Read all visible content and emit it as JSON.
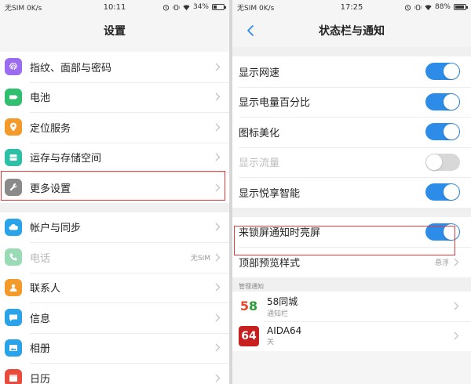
{
  "left": {
    "status": {
      "carrier": "无SIM 0K/s",
      "time": "10:11",
      "battery": "34%",
      "battery_level": 0.34
    },
    "title": "设置",
    "groups": [
      [
        {
          "label": "指纹、面部与密码",
          "icon": "fingerprint-icon",
          "color": "#9b6cf0"
        },
        {
          "label": "电池",
          "icon": "battery-icon",
          "color": "#2fbf6f"
        },
        {
          "label": "定位服务",
          "icon": "location-icon",
          "color": "#f39a2b"
        },
        {
          "label": "运存与存储空间",
          "icon": "storage-icon",
          "color": "#2ec0a6"
        },
        {
          "label": "更多设置",
          "icon": "wrench-icon",
          "color": "#8a8a8a"
        }
      ],
      [
        {
          "label": "帐户与同步",
          "icon": "cloud-icon",
          "color": "#2aa3e8"
        },
        {
          "label": "电话",
          "icon": "phone-icon",
          "color": "#9adbb6",
          "value": "无SIM",
          "dim": true
        },
        {
          "label": "联系人",
          "icon": "contacts-icon",
          "color": "#f39a2b"
        },
        {
          "label": "信息",
          "icon": "message-icon",
          "color": "#2aa3e8"
        },
        {
          "label": "相册",
          "icon": "album-icon",
          "color": "#2aa3e8"
        },
        {
          "label": "日历",
          "icon": "calendar-icon",
          "color": "#e84a3b"
        }
      ]
    ]
  },
  "right": {
    "status": {
      "carrier": "无SIM 0K/s",
      "time": "17:25",
      "battery": "88%",
      "battery_level": 0.88
    },
    "title": "状态栏与通知",
    "toggles_group": [
      {
        "label": "显示网速",
        "on": true
      },
      {
        "label": "显示电量百分比",
        "on": true
      },
      {
        "label": "图标美化",
        "on": true
      },
      {
        "label": "显示流量",
        "on": false,
        "dim": true
      },
      {
        "label": "显示悦享智能",
        "on": true
      }
    ],
    "lock_group": [
      {
        "label": "来锁屏通知时亮屏",
        "type": "toggle",
        "on": true
      },
      {
        "label": "顶部预览样式",
        "type": "nav",
        "value": "悬浮"
      }
    ],
    "section_header": "管理通知",
    "apps": [
      {
        "name": "58同城",
        "sub": "通知栏",
        "badge": "58",
        "color": "#ffffff"
      },
      {
        "name": "AIDA64",
        "sub": "关",
        "badge": "64",
        "color": "#c8201e"
      }
    ]
  }
}
